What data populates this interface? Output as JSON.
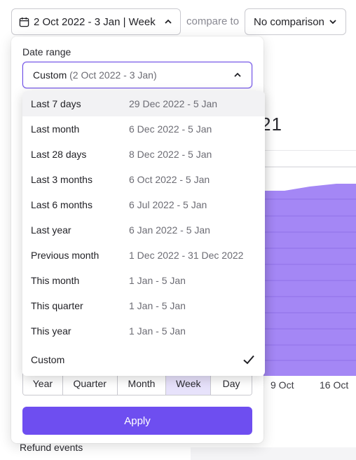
{
  "toolbar": {
    "range_label": "2 Oct 2022 - 3 Jan | Week",
    "compare_label": "compare to",
    "comparison_value": "No comparison"
  },
  "background": {
    "heading": "21",
    "x_ticks": [
      "9 Oct",
      "16 Oct"
    ],
    "section_label": "Refund events"
  },
  "popover": {
    "date_range_label": "Date range",
    "selected_main": "Custom",
    "selected_sub": "(2 Oct 2022 - 3 Jan)",
    "options": [
      {
        "name": "Last 7 days",
        "range": "29 Dec 2022 - 5 Jan"
      },
      {
        "name": "Last month",
        "range": "6 Dec 2022 - 5 Jan"
      },
      {
        "name": "Last 28 days",
        "range": "8 Dec 2022 - 5 Jan"
      },
      {
        "name": "Last 3 months",
        "range": "6 Oct 2022 - 5 Jan"
      },
      {
        "name": "Last 6 months",
        "range": "6 Jul 2022 - 5 Jan"
      },
      {
        "name": "Last year",
        "range": "6 Jan 2022 - 5 Jan"
      },
      {
        "name": "Previous month",
        "range": "1 Dec 2022 - 31 Dec 2022"
      },
      {
        "name": "This month",
        "range": "1 Jan - 5 Jan"
      },
      {
        "name": "This quarter",
        "range": "1 Jan - 5 Jan"
      },
      {
        "name": "This year",
        "range": "1 Jan - 5 Jan"
      },
      {
        "name": "Custom",
        "range": ""
      }
    ],
    "highlighted_option": "Last 7 days",
    "selected_option": "Custom",
    "granularity": [
      "Year",
      "Quarter",
      "Month",
      "Week",
      "Day"
    ],
    "active_granularity": "Week",
    "apply_label": "Apply"
  },
  "colors": {
    "accent": "#6e4ef0",
    "chart_fill": "#a487f5",
    "active_segment": "#e7e2fb"
  }
}
